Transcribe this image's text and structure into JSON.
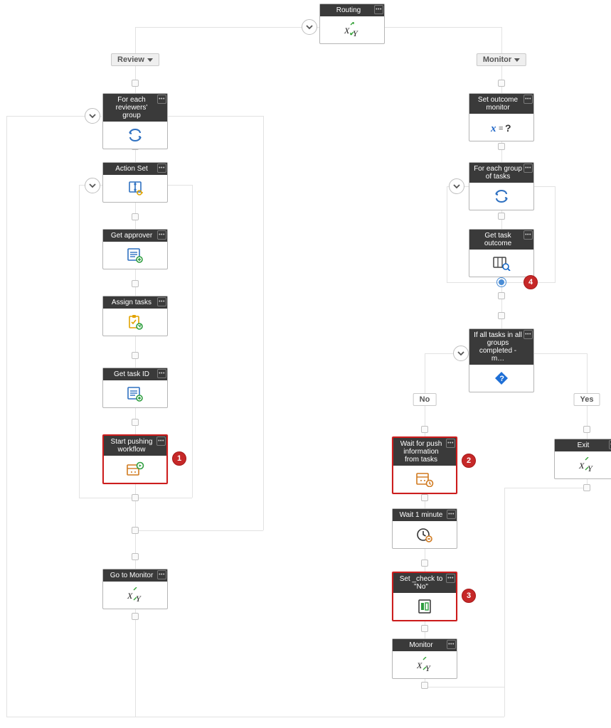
{
  "root": {
    "title": "Routing"
  },
  "branch": {
    "left": "Review",
    "right": "Monitor"
  },
  "left": {
    "foreach": "For each reviewers' group",
    "actionSet": "Action Set",
    "getApprover": "Get approver",
    "assignTasks": "Assign tasks",
    "getTaskId": "Get task ID",
    "startPush": "Start pushing workflow",
    "goMonitor": "Go to Monitor"
  },
  "right": {
    "setOutcome": "Set outcome monitor",
    "foreach": "For each group of tasks",
    "getTaskOutcome": "Get task outcome",
    "ifAll": "If all tasks in all groups completed - m…",
    "branch": {
      "no": "No",
      "yes": "Yes"
    },
    "waitPush": "Wait for push information from tasks",
    "wait1": "Wait 1 minute",
    "setCheck": "Set _check to \"No\"",
    "monitor": "Monitor",
    "exit": "Exit"
  },
  "badges": {
    "b1": "1",
    "b2": "2",
    "b3": "3",
    "b4": "4"
  }
}
